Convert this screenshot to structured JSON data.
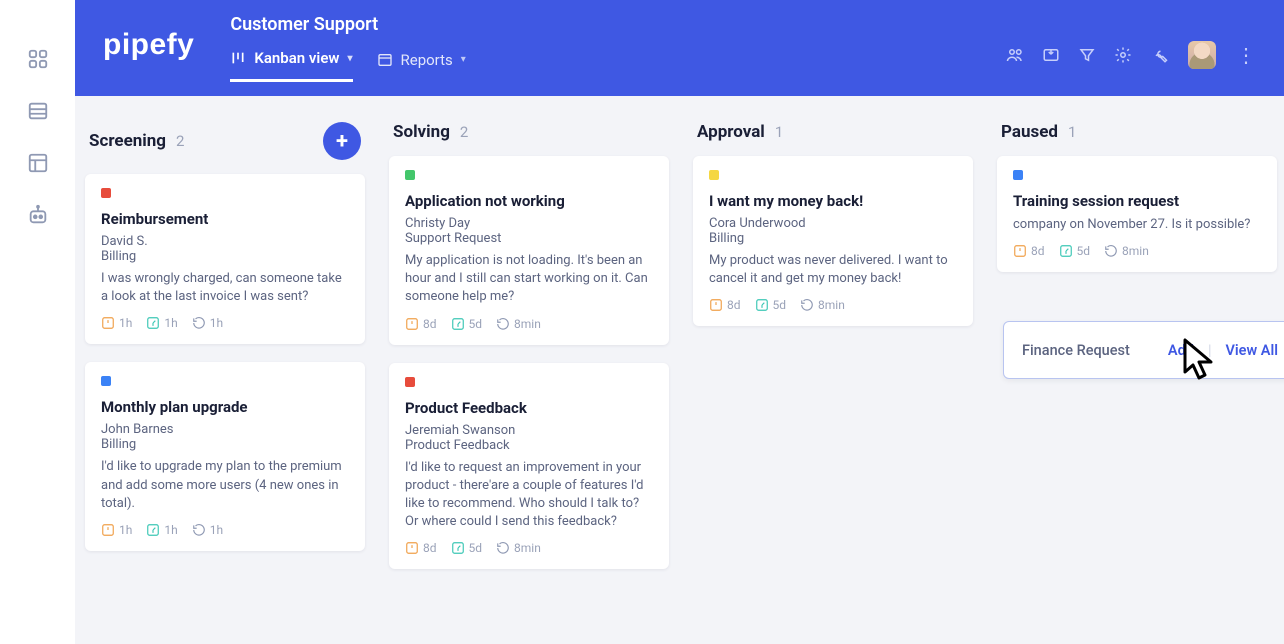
{
  "header": {
    "title": "Customer Support",
    "logo": "pipefy",
    "tabs": {
      "kanban": "Kanban view",
      "reports": "Reports"
    }
  },
  "rail": {
    "items": [
      "apps-icon",
      "list-icon",
      "layout-icon",
      "bot-icon"
    ]
  },
  "popup": {
    "title": "Finance Request",
    "add": "Add",
    "viewAll": "View All"
  },
  "columns": [
    {
      "title": "Screening",
      "count": "2",
      "showAdd": true,
      "cards": [
        {
          "dot": "red",
          "title": "Reimbursement",
          "name": "David S.",
          "category": "Billing",
          "desc": "I was wrongly charged, can someone take a look at the last invoice I was sent?",
          "meta": [
            "1h",
            "1h",
            "1h"
          ]
        },
        {
          "dot": "blue",
          "title": "Monthly plan upgrade",
          "name": "John Barnes",
          "category": "Billing",
          "desc": "I'd like to upgrade my plan to the premium and add some more users (4 new ones in total).",
          "meta": [
            "1h",
            "1h",
            "1h"
          ]
        }
      ]
    },
    {
      "title": "Solving",
      "count": "2",
      "showAdd": false,
      "cards": [
        {
          "dot": "green",
          "title": "Application not working",
          "name": "Christy Day",
          "category": "Support Request",
          "desc": "My application is not loading. It's been an hour and I still can start working on it. Can someone help me?",
          "meta": [
            "8d",
            "5d",
            "8min"
          ]
        },
        {
          "dot": "red",
          "title": "Product Feedback",
          "name": "Jeremiah Swanson",
          "category": "Product Feedback",
          "desc": "I'd like to request an improvement in your product - there'are a couple of features I'd like to recommend. Who should I talk to? Or where could I send this feedback?",
          "meta": [
            "8d",
            "5d",
            "8min"
          ]
        }
      ]
    },
    {
      "title": "Approval",
      "count": "1",
      "showAdd": false,
      "cards": [
        {
          "dot": "yellow",
          "title": "I want my money back!",
          "name": "Cora Underwood",
          "category": "Billing",
          "desc": "My product was never delivered. I want to cancel it and get my money back!",
          "meta": [
            "8d",
            "5d",
            "8min"
          ]
        }
      ]
    },
    {
      "title": "Paused",
      "count": "1",
      "showAdd": false,
      "cards": [
        {
          "dot": "blue",
          "title": "Training session request",
          "name": "",
          "category": "",
          "desc": "company on November 27. Is it possible?",
          "meta": [
            "8d",
            "5d",
            "8min"
          ]
        }
      ]
    }
  ]
}
